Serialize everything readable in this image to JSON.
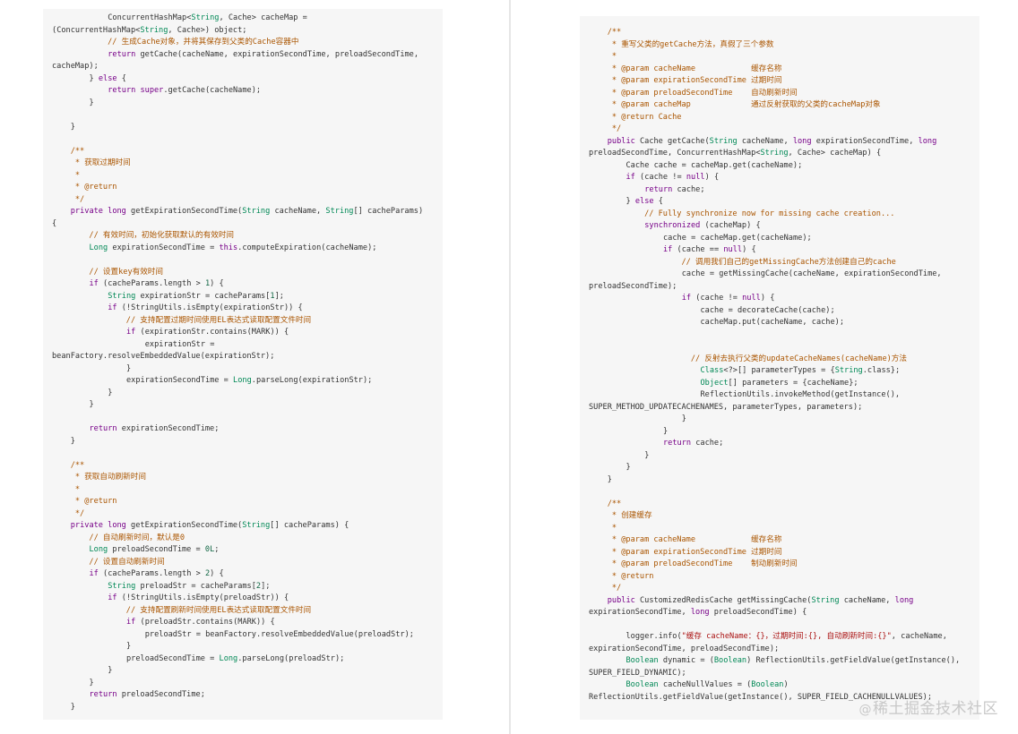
{
  "left_code": [
    {
      "text": "            ConcurrentHashMap<String, Cache> cacheMap =",
      "kind": "code"
    },
    {
      "text": "(ConcurrentHashMap<String, Cache>) object;",
      "kind": "code"
    },
    {
      "text": "            // 生成Cache对象，并将其保存到父类的Cache容器中",
      "kind": "comment"
    },
    {
      "text": "            return getCache(cacheName, expirationSecondTime, preloadSecondTime,",
      "kind": "code"
    },
    {
      "text": "cacheMap);",
      "kind": "code"
    },
    {
      "text": "        } else {",
      "kind": "code"
    },
    {
      "text": "            return super.getCache(cacheName);",
      "kind": "code"
    },
    {
      "text": "        }",
      "kind": "code"
    },
    {
      "text": "",
      "kind": "code"
    },
    {
      "text": "    }",
      "kind": "code"
    },
    {
      "text": "",
      "kind": "code"
    },
    {
      "text": "    /**",
      "kind": "comment"
    },
    {
      "text": "     * 获取过期时间",
      "kind": "comment"
    },
    {
      "text": "     *",
      "kind": "comment"
    },
    {
      "text": "     * @return",
      "kind": "comment"
    },
    {
      "text": "     */",
      "kind": "comment"
    },
    {
      "text": "    private long getExpirationSecondTime(String cacheName, String[] cacheParams)",
      "kind": "code"
    },
    {
      "text": "{",
      "kind": "code"
    },
    {
      "text": "        // 有效时间，初始化获取默认的有效时间",
      "kind": "comment"
    },
    {
      "text": "        Long expirationSecondTime = this.computeExpiration(cacheName);",
      "kind": "code"
    },
    {
      "text": "",
      "kind": "code"
    },
    {
      "text": "        // 设置key有效时间",
      "kind": "comment"
    },
    {
      "text": "        if (cacheParams.length > 1) {",
      "kind": "code"
    },
    {
      "text": "            String expirationStr = cacheParams[1];",
      "kind": "code"
    },
    {
      "text": "            if (!StringUtils.isEmpty(expirationStr)) {",
      "kind": "code"
    },
    {
      "text": "                // 支持配置过期时间使用EL表达式读取配置文件时间",
      "kind": "comment"
    },
    {
      "text": "                if (expirationStr.contains(MARK)) {",
      "kind": "code"
    },
    {
      "text": "                    expirationStr =",
      "kind": "code"
    },
    {
      "text": "beanFactory.resolveEmbeddedValue(expirationStr);",
      "kind": "code"
    },
    {
      "text": "                }",
      "kind": "code"
    },
    {
      "text": "                expirationSecondTime = Long.parseLong(expirationStr);",
      "kind": "code"
    },
    {
      "text": "            }",
      "kind": "code"
    },
    {
      "text": "        }",
      "kind": "code"
    },
    {
      "text": "",
      "kind": "code"
    },
    {
      "text": "        return expirationSecondTime;",
      "kind": "code"
    },
    {
      "text": "    }",
      "kind": "code"
    },
    {
      "text": "",
      "kind": "code"
    },
    {
      "text": "    /**",
      "kind": "comment"
    },
    {
      "text": "     * 获取自动刷新时间",
      "kind": "comment"
    },
    {
      "text": "     *",
      "kind": "comment"
    },
    {
      "text": "     * @return",
      "kind": "comment"
    },
    {
      "text": "     */",
      "kind": "comment"
    },
    {
      "text": "    private long getExpirationSecondTime(String[] cacheParams) {",
      "kind": "code"
    },
    {
      "text": "        // 自动刷新时间，默认是0",
      "kind": "comment"
    },
    {
      "text": "        Long preloadSecondTime = 0L;",
      "kind": "code"
    },
    {
      "text": "        // 设置自动刷新时间",
      "kind": "comment"
    },
    {
      "text": "        if (cacheParams.length > 2) {",
      "kind": "code"
    },
    {
      "text": "            String preloadStr = cacheParams[2];",
      "kind": "code"
    },
    {
      "text": "            if (!StringUtils.isEmpty(preloadStr)) {",
      "kind": "code"
    },
    {
      "text": "                // 支持配置刷新时间使用EL表达式读取配置文件时间",
      "kind": "comment"
    },
    {
      "text": "                if (preloadStr.contains(MARK)) {",
      "kind": "code"
    },
    {
      "text": "                    preloadStr = beanFactory.resolveEmbeddedValue(preloadStr);",
      "kind": "code"
    },
    {
      "text": "                }",
      "kind": "code"
    },
    {
      "text": "                preloadSecondTime = Long.parseLong(preloadStr);",
      "kind": "code"
    },
    {
      "text": "            }",
      "kind": "code"
    },
    {
      "text": "        }",
      "kind": "code"
    },
    {
      "text": "        return preloadSecondTime;",
      "kind": "code"
    },
    {
      "text": "    }",
      "kind": "code"
    }
  ],
  "right_code": [
    {
      "text": "    /**",
      "kind": "comment"
    },
    {
      "text": "     * 重写父类的getCache方法，真假了三个参数",
      "kind": "comment"
    },
    {
      "text": "     *",
      "kind": "comment"
    },
    {
      "text": "     * @param cacheName            缓存名称",
      "kind": "comment"
    },
    {
      "text": "     * @param expirationSecondTime 过期时间",
      "kind": "comment"
    },
    {
      "text": "     * @param preloadSecondTime    自动刷新时间",
      "kind": "comment"
    },
    {
      "text": "     * @param cacheMap             通过反射获取的父类的cacheMap对象",
      "kind": "comment"
    },
    {
      "text": "     * @return Cache",
      "kind": "comment"
    },
    {
      "text": "     */",
      "kind": "comment"
    },
    {
      "text": "    public Cache getCache(String cacheName, long expirationSecondTime, long",
      "kind": "code"
    },
    {
      "text": "preloadSecondTime, ConcurrentHashMap<String, Cache> cacheMap) {",
      "kind": "code"
    },
    {
      "text": "        Cache cache = cacheMap.get(cacheName);",
      "kind": "code"
    },
    {
      "text": "        if (cache != null) {",
      "kind": "code"
    },
    {
      "text": "            return cache;",
      "kind": "code"
    },
    {
      "text": "        } else {",
      "kind": "code"
    },
    {
      "text": "            // Fully synchronize now for missing cache creation...",
      "kind": "comment"
    },
    {
      "text": "            synchronized (cacheMap) {",
      "kind": "code"
    },
    {
      "text": "                cache = cacheMap.get(cacheName);",
      "kind": "code"
    },
    {
      "text": "                if (cache == null) {",
      "kind": "code"
    },
    {
      "text": "                    // 调用我们自己的getMissingCache方法创建自己的cache",
      "kind": "comment"
    },
    {
      "text": "                    cache = getMissingCache(cacheName, expirationSecondTime,",
      "kind": "code"
    },
    {
      "text": "preloadSecondTime);",
      "kind": "code"
    },
    {
      "text": "                    if (cache != null) {",
      "kind": "code"
    },
    {
      "text": "                        cache = decorateCache(cache);",
      "kind": "code"
    },
    {
      "text": "                        cacheMap.put(cacheName, cache);",
      "kind": "code"
    },
    {
      "text": "",
      "kind": "code"
    },
    {
      "text": "",
      "kind": "code"
    },
    {
      "text": "                      // 反射去执行父类的updateCacheNames(cacheName)方法",
      "kind": "comment"
    },
    {
      "text": "                        Class<?>[] parameterTypes = {String.class};",
      "kind": "code"
    },
    {
      "text": "                        Object[] parameters = {cacheName};",
      "kind": "code"
    },
    {
      "text": "                        ReflectionUtils.invokeMethod(getInstance(),",
      "kind": "code"
    },
    {
      "text": "SUPER_METHOD_UPDATECACHENAMES, parameterTypes, parameters);",
      "kind": "code"
    },
    {
      "text": "                    }",
      "kind": "code"
    },
    {
      "text": "                }",
      "kind": "code"
    },
    {
      "text": "                return cache;",
      "kind": "code"
    },
    {
      "text": "            }",
      "kind": "code"
    },
    {
      "text": "        }",
      "kind": "code"
    },
    {
      "text": "    }",
      "kind": "code"
    },
    {
      "text": "",
      "kind": "code"
    },
    {
      "text": "    /**",
      "kind": "comment"
    },
    {
      "text": "     * 创建缓存",
      "kind": "comment"
    },
    {
      "text": "     *",
      "kind": "comment"
    },
    {
      "text": "     * @param cacheName            缓存名称",
      "kind": "comment"
    },
    {
      "text": "     * @param expirationSecondTime 过期时间",
      "kind": "comment"
    },
    {
      "text": "     * @param preloadSecondTime    制动刷新时间",
      "kind": "comment"
    },
    {
      "text": "     * @return",
      "kind": "comment"
    },
    {
      "text": "     */",
      "kind": "comment"
    },
    {
      "text": "    public CustomizedRedisCache getMissingCache(String cacheName, long",
      "kind": "code"
    },
    {
      "text": "expirationSecondTime, long preloadSecondTime) {",
      "kind": "code"
    },
    {
      "text": "",
      "kind": "code"
    },
    {
      "text": "        logger.info(\"缓存 cacheName：{}，过期时间:{}, 自动刷新时间:{}\", cacheName,",
      "kind": "code"
    },
    {
      "text": "expirationSecondTime, preloadSecondTime);",
      "kind": "code"
    },
    {
      "text": "        Boolean dynamic = (Boolean) ReflectionUtils.getFieldValue(getInstance(),",
      "kind": "code"
    },
    {
      "text": "SUPER_FIELD_DYNAMIC);",
      "kind": "code"
    },
    {
      "text": "        Boolean cacheNullValues = (Boolean)",
      "kind": "code"
    },
    {
      "text": "ReflectionUtils.getFieldValue(getInstance(), SUPER_FIELD_CACHENULLVALUES);",
      "kind": "code"
    }
  ],
  "watermark": {
    "at": "@",
    "text": "稀土掘金技术社区"
  },
  "colors": {
    "keyword": "#770088",
    "type": "#008855",
    "comment": "#aa5500",
    "string": "#aa1111",
    "number": "#116644",
    "text": "#333333",
    "background": "#f6f6f6"
  }
}
